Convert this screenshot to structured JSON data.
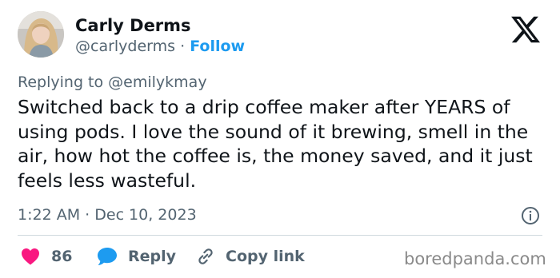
{
  "author": {
    "name": "Carly Derms",
    "handle": "@carlyderms",
    "separator": "·",
    "follow_label": "Follow"
  },
  "reply_to": {
    "prefix": "Replying to",
    "handle": "@emilykmay"
  },
  "tweet": {
    "text": "Switched back to a drip coffee maker after YEARS of using pods. I love the sound of it brewing, smell in the air, how hot the coffee is, the money saved, and it just feels less wasteful.",
    "time": "1:22 AM",
    "date": "Dec 10, 2023",
    "separator": "·"
  },
  "actions": {
    "like_count": "86",
    "reply_label": "Reply",
    "copy_link_label": "Copy link"
  },
  "colors": {
    "like": "#f91880",
    "reply": "#1d9bf0",
    "follow": "#1d9bf0",
    "muted": "#536471"
  },
  "icons": [
    "x-logo-icon",
    "info-icon",
    "heart-icon",
    "reply-bubble-icon",
    "link-icon"
  ],
  "watermark": "boredpanda.com"
}
